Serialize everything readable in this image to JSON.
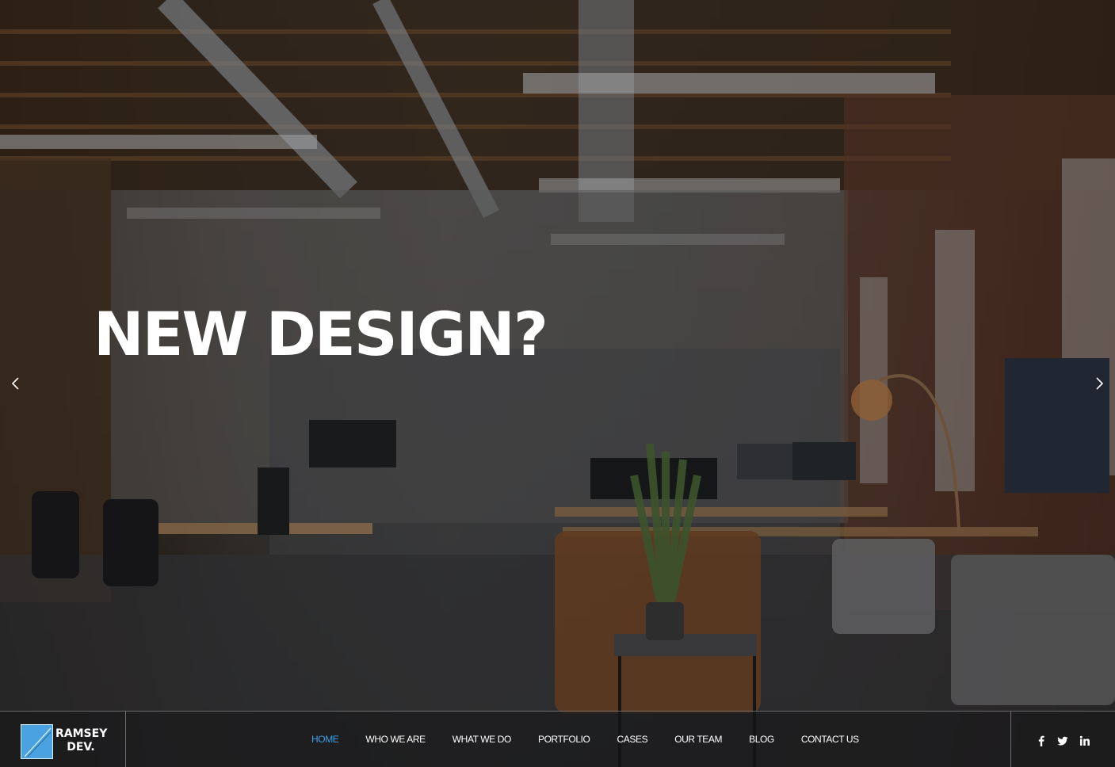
{
  "hero": {
    "title": "NEW DESIGN?"
  },
  "slider": {
    "prev_icon": "chevron-left-icon",
    "next_icon": "chevron-right-icon"
  },
  "brand": {
    "line1": "RAMSEY",
    "line2": "DEV.",
    "accent": "#4aa3e0"
  },
  "nav": {
    "items": [
      {
        "label": "HOME",
        "active": true
      },
      {
        "label": "WHO WE ARE"
      },
      {
        "label": "WHAT WE DO"
      },
      {
        "label": "PORTFOLIO"
      },
      {
        "label": "CASES"
      },
      {
        "label": "OUR TEAM"
      },
      {
        "label": "BLOG"
      },
      {
        "label": "CONTACT US"
      }
    ],
    "active_color": "#3aa0e8"
  },
  "social": {
    "icons": [
      "facebook-icon",
      "twitter-icon",
      "linkedin-icon"
    ]
  }
}
